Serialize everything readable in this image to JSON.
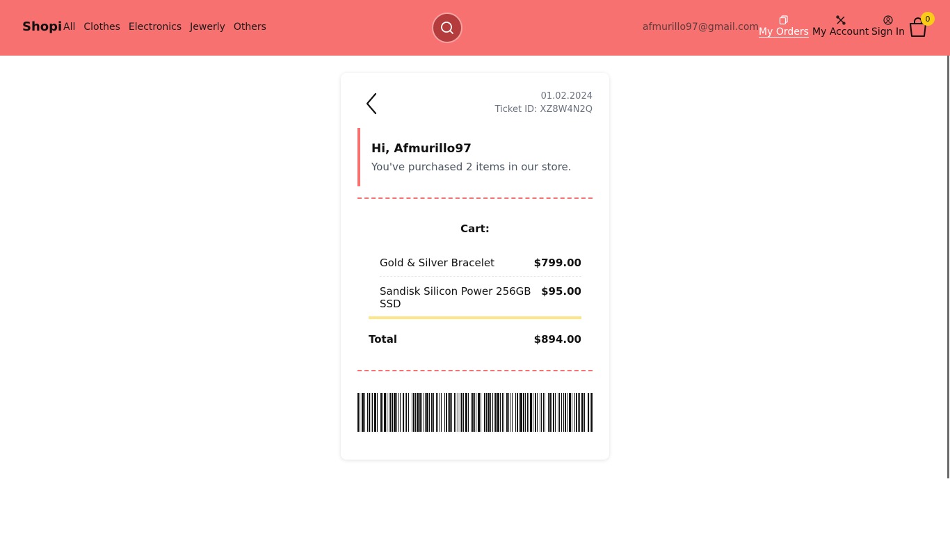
{
  "nav": {
    "brand": "Shopi",
    "categories": [
      "All",
      "Clothes",
      "Electronics",
      "Jewerly",
      "Others"
    ],
    "email": "afmurillo97@gmail.com",
    "my_orders": "My Orders",
    "my_account": "My Account",
    "sign_in": "Sign In",
    "cart_count": "0"
  },
  "ticket": {
    "date": "01.02.2024",
    "ticket_id": "Ticket ID: XZ8W4N2Q",
    "greeting": "Hi, Afmurillo97",
    "summary": "You've purchased 2 items in our store.",
    "cart_title": "Cart:",
    "items": [
      {
        "name": "Gold & Silver Bracelet",
        "price": "$799.00"
      },
      {
        "name": "Sandisk Silicon Power 256GB SSD",
        "price": "$95.00"
      }
    ],
    "total_label": "Total",
    "total_value": "$894.00"
  },
  "icons": {
    "search": "search-icon",
    "orders": "clipboard-icon",
    "account": "tools-icon",
    "sign_in": "user-circle-icon",
    "cart": "shopping-bag-icon",
    "back": "chevron-left-icon"
  },
  "colors": {
    "navbar": "#f87171",
    "accent": "#f87171",
    "badge": "#facc15",
    "total_bar": "#fde68a"
  }
}
